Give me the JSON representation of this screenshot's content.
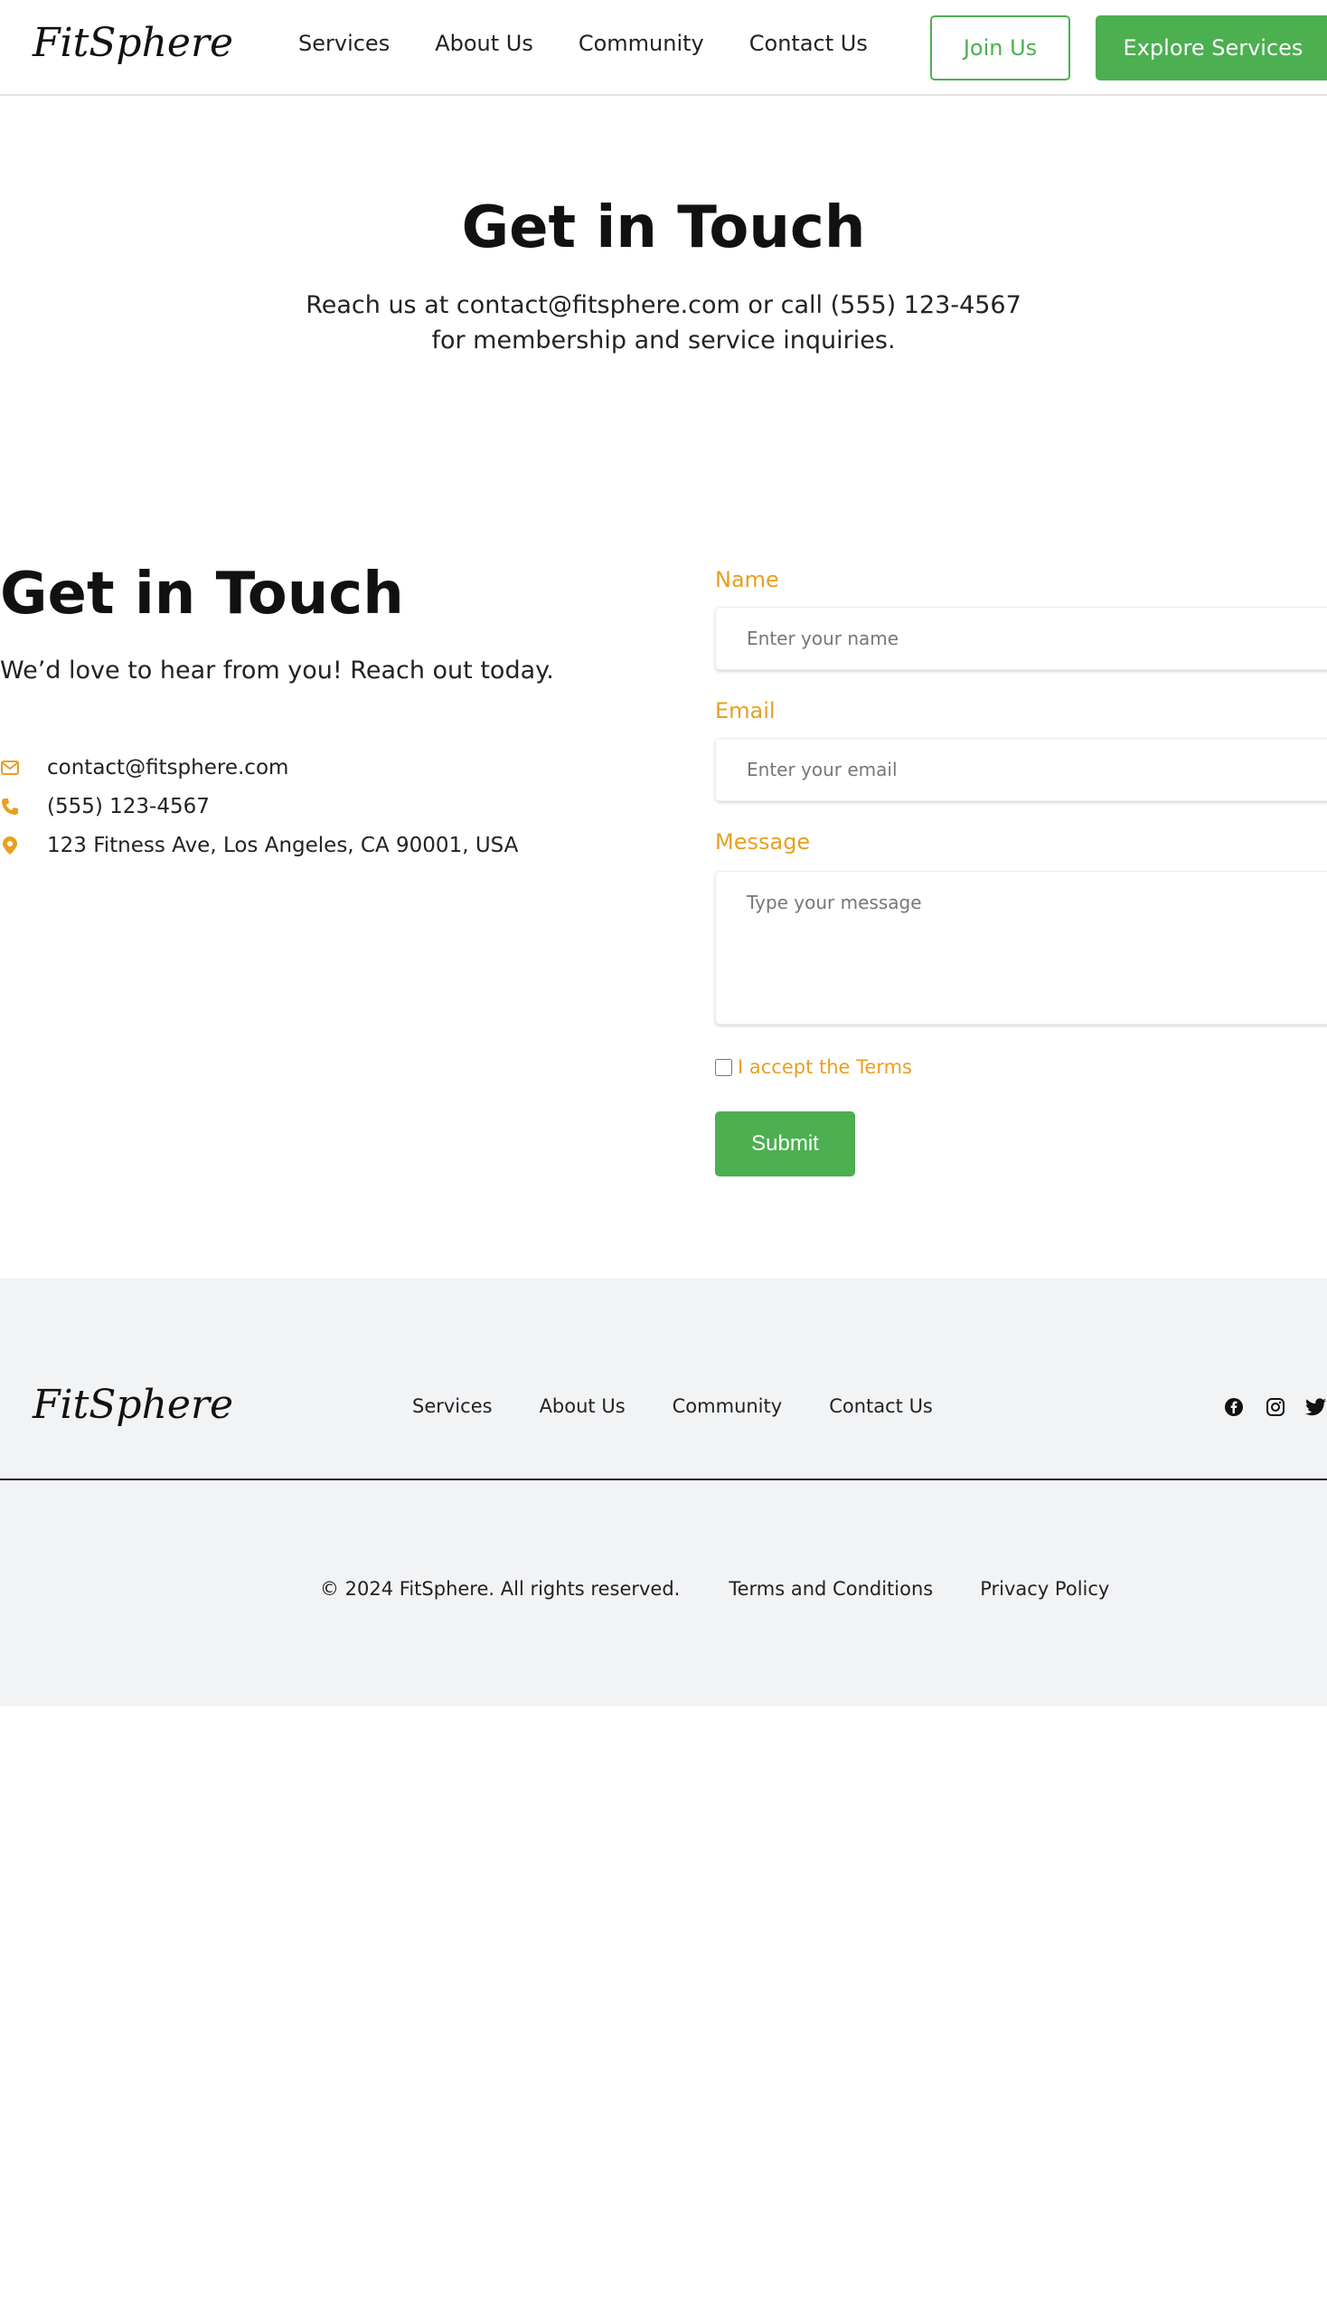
{
  "header": {
    "logo": "FitSphere",
    "nav": [
      "Services",
      "About Us",
      "Community",
      "Contact Us"
    ],
    "join_label": "Join Us",
    "explore_label": "Explore Services"
  },
  "hero": {
    "title": "Get in Touch",
    "text": "Reach us at contact@fitsphere.com or call (555) 123-4567 for membership and service inquiries."
  },
  "contact": {
    "title": "Get in Touch",
    "subtitle": "We’d love to hear from you! Reach out today.",
    "email": "contact@fitsphere.com",
    "phone": "(555) 123-4567",
    "address": "123 Fitness Ave, Los Angeles, CA 90001, USA"
  },
  "form": {
    "name_label": "Name",
    "name_placeholder": "Enter your name",
    "email_label": "Email",
    "email_placeholder": "Enter your email",
    "message_label": "Message",
    "message_placeholder": "Type your message",
    "terms_label": "I accept the Terms",
    "terms_checked": false,
    "submit_label": "Submit"
  },
  "footer": {
    "logo": "FitSphere",
    "nav": [
      "Services",
      "About Us",
      "Community",
      "Contact Us"
    ],
    "social_icons": [
      "facebook-icon",
      "instagram-icon",
      "twitter-icon"
    ],
    "copyright": "© 2024 FitSphere. All rights reserved.",
    "terms_link": "Terms and Conditions",
    "privacy_link": "Privacy Policy"
  },
  "colors": {
    "accent_green": "#4caf50",
    "accent_orange": "#e8a020",
    "footer_bg": "#f2f3f5"
  }
}
